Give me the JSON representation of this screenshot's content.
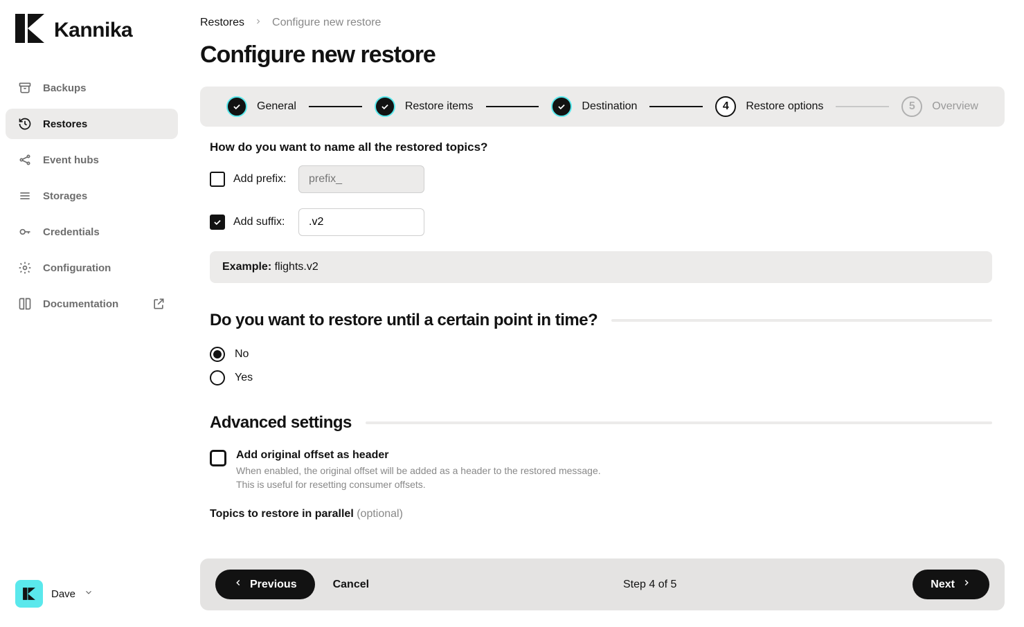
{
  "brand": "Kannika",
  "nav": {
    "items": [
      {
        "id": "backups",
        "label": "Backups",
        "active": false
      },
      {
        "id": "restores",
        "label": "Restores",
        "active": true
      },
      {
        "id": "event-hubs",
        "label": "Event hubs",
        "active": false
      },
      {
        "id": "storages",
        "label": "Storages",
        "active": false
      },
      {
        "id": "credentials",
        "label": "Credentials",
        "active": false
      },
      {
        "id": "configuration",
        "label": "Configuration",
        "active": false
      },
      {
        "id": "documentation",
        "label": "Documentation",
        "active": false,
        "external": true
      }
    ]
  },
  "user": {
    "name": "Dave"
  },
  "breadcrumb": {
    "root": "Restores",
    "current": "Configure new restore"
  },
  "page_title": "Configure new restore",
  "steps": [
    {
      "label": "General",
      "state": "done"
    },
    {
      "label": "Restore items",
      "state": "done"
    },
    {
      "label": "Destination",
      "state": "done"
    },
    {
      "label": "Restore options",
      "state": "current",
      "number": "4"
    },
    {
      "label": "Overview",
      "state": "pending",
      "number": "5"
    }
  ],
  "form": {
    "naming_question": "How do you want to name all the restored topics?",
    "prefix": {
      "label": "Add prefix:",
      "checked": false,
      "placeholder": "prefix_",
      "value": ""
    },
    "suffix": {
      "label": "Add suffix:",
      "checked": true,
      "value": ".v2"
    },
    "example": {
      "label": "Example:",
      "value": "flights.v2"
    },
    "pit_question": "Do you want to restore until a certain point in time?",
    "pit_options": {
      "no": "No",
      "yes": "Yes",
      "selected": "no"
    },
    "advanced_title": "Advanced settings",
    "offset_header": {
      "label": "Add original offset as header",
      "help1": "When enabled, the original offset will be added as a header to the restored message.",
      "help2": "This is useful for resetting consumer offsets.",
      "checked": false
    },
    "parallel": {
      "label": "Topics to restore in parallel",
      "optional": "(optional)"
    }
  },
  "footer": {
    "previous": "Previous",
    "cancel": "Cancel",
    "step_text": "Step 4 of 5",
    "next": "Next"
  }
}
